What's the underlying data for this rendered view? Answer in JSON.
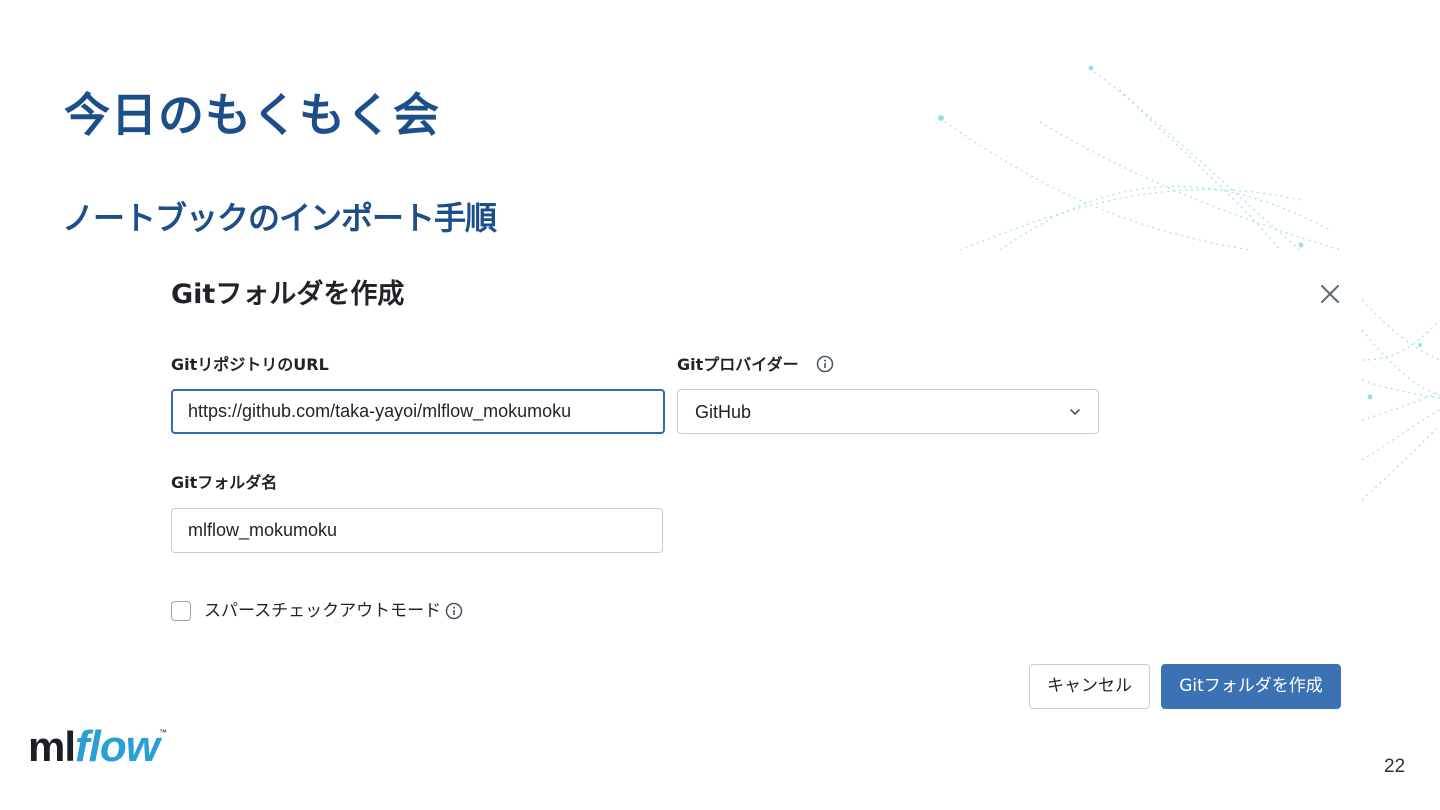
{
  "slide": {
    "title": "今日のもくもく会",
    "subtitle": "ノートブックのインポート手順",
    "page_number": "22"
  },
  "dialog": {
    "title": "Gitフォルダを作成",
    "repo_url_label": "GitリポジトリのURL",
    "repo_url_value": "https://github.com/taka-yayoi/mlflow_mokumoku",
    "provider_label": "Gitプロバイダー",
    "provider_value": "GitHub",
    "folder_name_label": "Gitフォルダ名",
    "folder_name_value": "mlflow_mokumoku",
    "sparse_checkout_label": "スパースチェックアウトモード",
    "sparse_checkout_checked": false,
    "cancel_label": "キャンセル",
    "create_label": "Gitフォルダを作成"
  },
  "logo": {
    "ml": "ml",
    "flow": "flow",
    "tm": "™"
  },
  "icons": {
    "close": "close-icon",
    "info": "info-icon",
    "chevron": "chevron-down-icon"
  },
  "colors": {
    "title": "#1c4f8a",
    "primary_button": "#3c72b4",
    "focus_border": "#2f6bb5",
    "logo_flow": "#2a9fd6",
    "decoration": "#7fd8e6"
  }
}
